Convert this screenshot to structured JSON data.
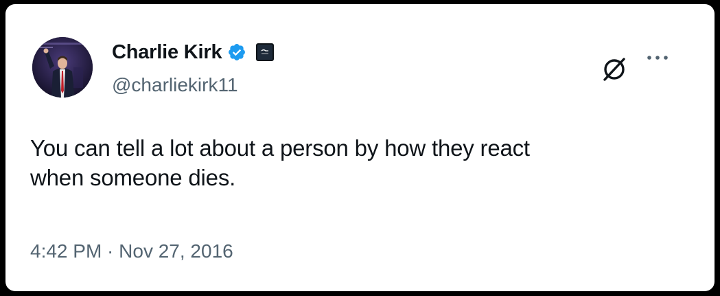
{
  "tweet": {
    "author": {
      "display_name": "Charlie Kirk",
      "handle": "@charliekirk11",
      "verified_badge_icon": "verified-badge-icon",
      "affiliate_badge_icon": "affiliate-badge-icon",
      "avatar": "avatar"
    },
    "text": "You can tell a lot about a person by how they react\nwhen someone dies.",
    "timestamp": "4:42 PM · Nov 27, 2016",
    "actions": {
      "grok_icon": "grok-icon",
      "more_icon": "more-icon"
    }
  },
  "colors": {
    "background": "#000000",
    "card": "#ffffff",
    "primary_text": "#0f1419",
    "secondary_text": "#536471",
    "verified_blue": "#1d9bf0"
  }
}
